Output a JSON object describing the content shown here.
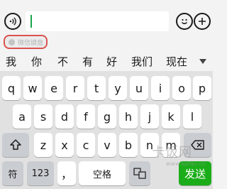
{
  "chat_bar": {
    "input_value": ""
  },
  "wechat_keyboard_label": "微信键盘",
  "candidates": [
    "我",
    "你",
    "不",
    "有",
    "好",
    "我们",
    "现在"
  ],
  "keyboard": {
    "row1": [
      "q",
      "w",
      "e",
      "r",
      "t",
      "y",
      "u",
      "i",
      "o",
      "p"
    ],
    "row2": [
      "a",
      "s",
      "d",
      "f",
      "g",
      "h",
      "j",
      "k",
      "l"
    ],
    "row3": [
      "z",
      "x",
      "c",
      "v",
      "b",
      "n",
      "m"
    ],
    "symbol_key": "符",
    "number_key": "123",
    "comma_key": "，",
    "space_key": "空格",
    "send_key": "发送"
  },
  "watermark": {
    "brand": "卡饭网",
    "url": "www.kafan.cn"
  },
  "colors": {
    "accent": "#1aad19",
    "highlight_border": "#d9534f"
  }
}
